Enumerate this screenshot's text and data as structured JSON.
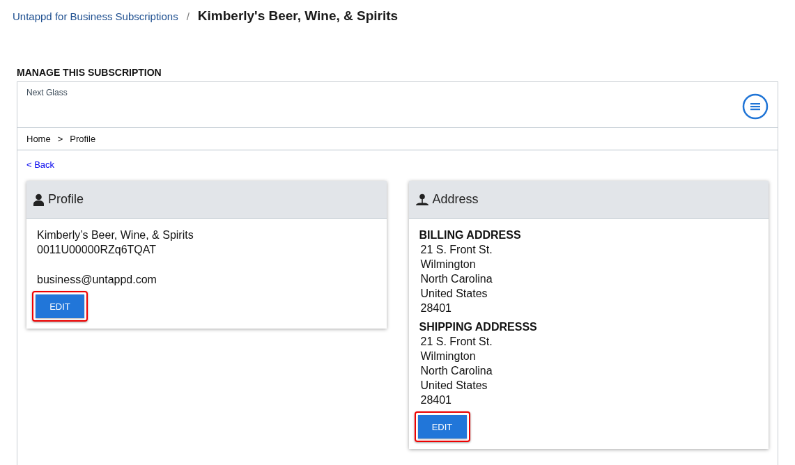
{
  "breadcrumb": {
    "link": "Untappd for Business Subscriptions",
    "separator": "/",
    "current": "Kimberly's Beer, Wine, & Spirits"
  },
  "section_title": "MANAGE THIS SUBSCRIPTION",
  "panel": {
    "brand": "Next Glass",
    "trail": [
      {
        "label": "Home"
      },
      {
        "label": ">"
      },
      {
        "label": "Profile"
      }
    ],
    "back_link": "< Back",
    "cards": [
      {
        "kind": "profile",
        "title": "Profile",
        "lines": [
          "Kimberly’s Beer, Wine, & Spirits",
          "0011U00000RZq6TQAT"
        ],
        "email": "business@untappd.com",
        "button": {
          "label": "EDIT",
          "highlighted": true
        }
      },
      {
        "kind": "address",
        "title": "Address",
        "sections": [
          {
            "heading": "BILLING ADDRESS",
            "lines": [
              "21 S. Front St.",
              "Wilmington",
              "North Carolina",
              "United States",
              "28401"
            ]
          },
          {
            "heading": "SHIPPING ADDRESSS",
            "lines": [
              "21 S. Front St.",
              "Wilmington",
              "North Carolina",
              "United States",
              "28401"
            ]
          }
        ],
        "button": {
          "label": "EDIT",
          "highlighted": true
        }
      }
    ]
  }
}
